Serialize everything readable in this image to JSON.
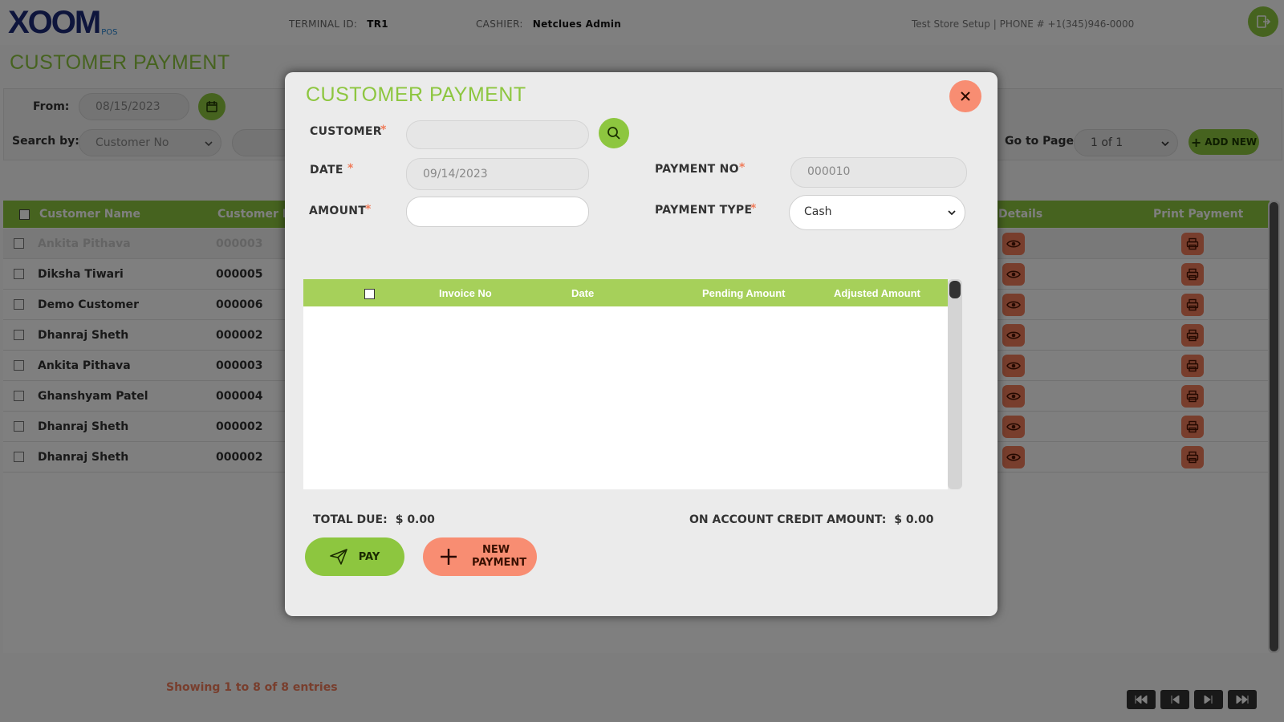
{
  "header": {
    "logo_main": "XOOM",
    "logo_sub": "POS",
    "terminal_label": "TERMINAL ID:",
    "terminal_value": "TR1",
    "cashier_label": "CASHIER:",
    "cashier_value": "Netclues Admin",
    "store_info": "Test Store Setup | PHONE # +1(345)946-0000",
    "logout_icon": "logout-icon"
  },
  "page": {
    "title": "CUSTOMER PAYMENT"
  },
  "filters": {
    "from_label": "From:",
    "from_value": "08/15/2023",
    "search_by_label": "Search by:",
    "search_by_value": "Customer No",
    "goto_label": "Go to Page",
    "page_value": "1 of 1",
    "add_new_label": "ADD NEW"
  },
  "grid": {
    "columns": [
      "Customer Name",
      "Customer N",
      "Details",
      "Print Payment"
    ],
    "rows": [
      {
        "name": "Ankita Pithava",
        "no": "000003"
      },
      {
        "name": "Diksha Tiwari",
        "no": "000005"
      },
      {
        "name": "Demo Customer",
        "no": "000006"
      },
      {
        "name": "Dhanraj Sheth",
        "no": "000002"
      },
      {
        "name": "Ankita Pithava",
        "no": "000003"
      },
      {
        "name": "Ghanshyam Patel",
        "no": "000004"
      },
      {
        "name": "Dhanraj Sheth",
        "no": "000002"
      },
      {
        "name": "Dhanraj Sheth",
        "no": "000002"
      }
    ],
    "showing": "Showing 1 to 8 of 8 entries"
  },
  "modal": {
    "title": "CUSTOMER PAYMENT",
    "customer_label": "CUSTOMER",
    "customer_value": "",
    "date_label": "DATE",
    "date_value": "09/14/2023",
    "payment_no_label": "PAYMENT NO",
    "payment_no_value": "000010",
    "amount_label": "AMOUNT",
    "amount_value": "",
    "payment_type_label": "PAYMENT TYPE",
    "payment_type_value": "Cash",
    "required_mark": "*",
    "table_columns": [
      "Invoice No",
      "Date",
      "Pending Amount",
      "Adjusted Amount"
    ],
    "total_due_label": "TOTAL DUE:",
    "total_due_value": "$ 0.00",
    "credit_label": "ON ACCOUNT CREDIT AMOUNT:",
    "credit_value": "$ 0.00",
    "pay_label": "PAY",
    "new_payment_line1": "NEW",
    "new_payment_line2": "PAYMENT"
  },
  "colors": {
    "brand_green": "#8dc63f",
    "accent_orange": "#f07c5a",
    "logo_navy": "#1d2b78",
    "logo_blue": "#1d7fd0"
  }
}
